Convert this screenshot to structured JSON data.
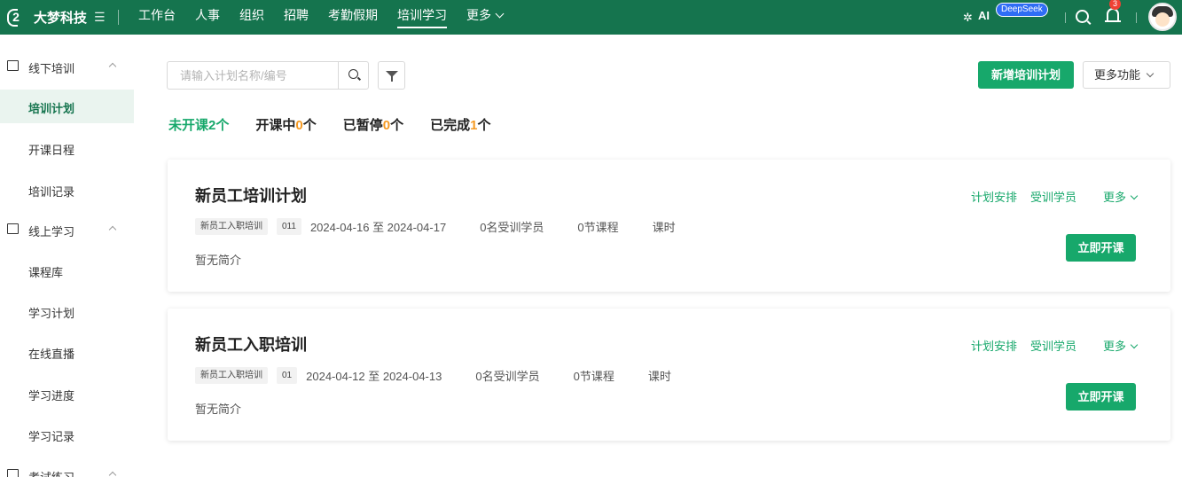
{
  "topbar": {
    "logo_mark": "2",
    "company_name": "大梦科技",
    "menu_icon": "menu-icon",
    "nav": [
      {
        "label": "工作台"
      },
      {
        "label": "人事"
      },
      {
        "label": "组织"
      },
      {
        "label": "招聘"
      },
      {
        "label": "考勤假期"
      },
      {
        "label": "培训学习",
        "active": true
      },
      {
        "label": "更多"
      }
    ],
    "ai_label": "AI",
    "deepseek_badge": "DeepSeek",
    "notification_count": "3"
  },
  "sidebar": {
    "groups": [
      {
        "label": "线下培训",
        "icon": "classroom-icon",
        "items": [
          {
            "label": "培训计划",
            "active": true
          },
          {
            "label": "开课日程"
          },
          {
            "label": "培训记录"
          }
        ]
      },
      {
        "label": "线上学习",
        "icon": "online-icon",
        "items": [
          {
            "label": "课程库"
          },
          {
            "label": "学习计划"
          },
          {
            "label": "在线直播"
          },
          {
            "label": "学习进度"
          },
          {
            "label": "学习记录"
          }
        ]
      },
      {
        "label": "考试练习",
        "icon": "exam-icon",
        "items": []
      }
    ]
  },
  "search": {
    "placeholder": "请输入计划名称/编号"
  },
  "actions": {
    "add_label": "新增培训计划",
    "more_label": "更多功能"
  },
  "status_tabs": [
    {
      "label": "未开课",
      "count": "2",
      "suffix": "个",
      "active": true
    },
    {
      "label": "开课中",
      "count": "0",
      "suffix": "个"
    },
    {
      "label": "已暂停",
      "count": "0",
      "suffix": "个"
    },
    {
      "label": "已完成",
      "count": "1",
      "suffix": "个"
    }
  ],
  "plans": [
    {
      "title": "新员工培训计划",
      "tag": "新员工入职培训",
      "code": "011",
      "date_range": "2024-04-16 至 2024-04-17",
      "trainees": "0名受训学员",
      "courses": "0节课程",
      "hours": "课时",
      "description": "暂无简介",
      "link_schedule": "计划安排",
      "link_trainees": "受训学员",
      "link_more": "更多",
      "start_label": "立即开课"
    },
    {
      "title": "新员工入职培训",
      "tag": "新员工入职培训",
      "code": "01",
      "date_range": "2024-04-12 至 2024-04-13",
      "trainees": "0名受训学员",
      "courses": "0节课程",
      "hours": "课时",
      "description": "暂无简介",
      "link_schedule": "计划安排",
      "link_trainees": "受训学员",
      "link_more": "更多",
      "start_label": "立即开课"
    }
  ]
}
